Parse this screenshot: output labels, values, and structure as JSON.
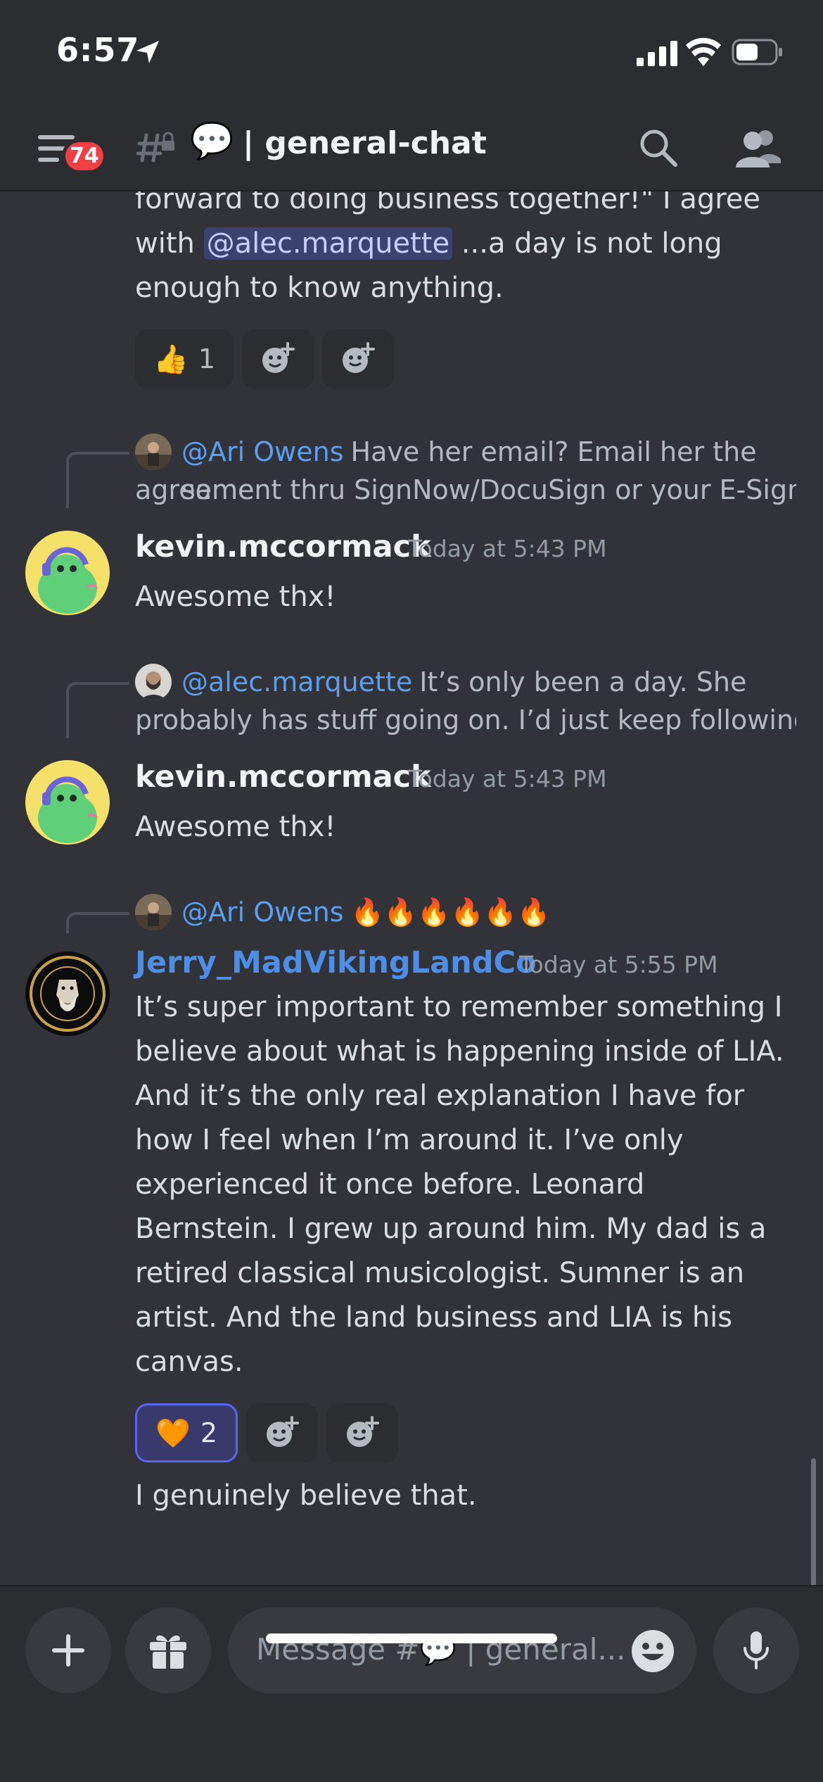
{
  "status_bar": {
    "time": "6:57"
  },
  "header": {
    "badge_count": "74",
    "channel_emoji": "💬",
    "channel_name": "| general-chat"
  },
  "messages": {
    "top_message": {
      "line1": "forward to doing business together!\" I agree",
      "line2_pre": "with ",
      "mention": "@alec.marquette",
      "line2_post": " ...a day is not long",
      "line3": "enough to know anything.",
      "reactions": [
        {
          "emoji": "👍",
          "count": "1"
        }
      ]
    },
    "msg1": {
      "reply_name": "@Ari Owens",
      "reply_text_1": "Have her email? Email her the same",
      "reply_text_2": "agreement thru SignNow/DocuSign or your E-Sign ...",
      "username": "kevin.mccormack",
      "timestamp": "Today at 5:43 PM",
      "text": "Awesome thx!"
    },
    "msg2": {
      "reply_name": "@alec.marquette",
      "reply_text_1": "It’s only been a day. She",
      "reply_text_2": "probably has stuff going on. I’d just keep following...",
      "username": "kevin.mccormack",
      "timestamp": "Today at 5:43 PM",
      "text": "Awesome thx!"
    },
    "msg3": {
      "reply_name": "@Ari Owens",
      "reply_text_1": "🔥🔥🔥🔥🔥🔥",
      "username": "Jerry_MadVikingLandCo",
      "timestamp": "Today at 5:55 PM",
      "lines": [
        "It’s super important to remember something I",
        "believe about what is happening inside of LIA.",
        "And it’s the only real explanation I have for",
        "how I feel when I’m around it.   I’ve only",
        "experienced it once before.  Leonard",
        "Bernstein.  I grew up around him.  My dad is a",
        "retired classical musicologist.   Sumner is an",
        "artist.  And the land business and LIA is his",
        "canvas."
      ],
      "reactions": [
        {
          "emoji": "🧡",
          "count": "2"
        }
      ],
      "followup": "I genuinely believe that."
    }
  },
  "composer": {
    "placeholder_prefix": "Message #",
    "placeholder_emoji": "💬",
    "placeholder_suffix": " | general..."
  },
  "colors": {
    "background": "#313338",
    "header": "#2b2d31",
    "accent": "#5865f2",
    "mention_bg": "#3c4270",
    "badge": "#f23f43",
    "link_blue": "#4d8fe8"
  }
}
